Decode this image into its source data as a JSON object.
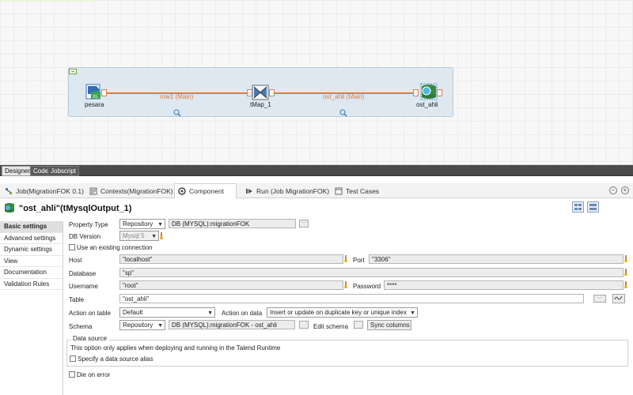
{
  "designer": {
    "components": [
      {
        "label": "pesara"
      },
      {
        "label": "tMap_1"
      },
      {
        "label": "ost_ahli"
      }
    ],
    "connections": [
      {
        "label": "row1 (Main)"
      },
      {
        "label": "ost_ahli (Main)"
      }
    ],
    "tabs": [
      "Designer",
      "Code",
      "Jobscript"
    ]
  },
  "views": {
    "tabs": [
      {
        "label": "Job(MigrationFOK 0.1)",
        "icon": "job-icon"
      },
      {
        "label": "Contexts(MigrationFOK)",
        "icon": "contexts-icon"
      },
      {
        "label": "Component",
        "icon": "component-icon"
      },
      {
        "label": "Run (Job MigrationFOK)",
        "icon": "run-icon"
      },
      {
        "label": "Test Cases",
        "icon": "testcases-icon"
      }
    ]
  },
  "component": {
    "title": "\"ost_ahli\"(tMysqlOutput_1)",
    "sidebar": [
      "Basic settings",
      "Advanced settings",
      "Dynamic settings",
      "View",
      "Documentation",
      "Validation Rules"
    ],
    "property_type": {
      "label": "Property Type",
      "value": "Repository",
      "repo": "DB (MYSQL):migrationFOK"
    },
    "db_version": {
      "label": "DB Version",
      "value": "Mysql 5"
    },
    "use_existing": {
      "label": "Use an existing connection"
    },
    "host": {
      "label": "Host",
      "value": "\"localhost\""
    },
    "port": {
      "label": "Port",
      "value": "\"3306\""
    },
    "database": {
      "label": "Database",
      "value": "\"sp\""
    },
    "username": {
      "label": "Username",
      "value": "\"root\""
    },
    "password": {
      "label": "Password",
      "value": "****"
    },
    "table": {
      "label": "Table",
      "value": "\"ost_ahli\""
    },
    "action_on_table": {
      "label": "Action on table",
      "value": "Default"
    },
    "action_on_data": {
      "label": "Action on data",
      "value": "Insert or update on duplicate key or unique index"
    },
    "schema": {
      "label": "Schema",
      "value": "Repository",
      "repo": "DB (MYSQL):migrationFOK - ost_ahli"
    },
    "edit_schema": {
      "label": "Edit schema"
    },
    "sync_columns": {
      "label": "Sync columns"
    },
    "data_source": {
      "legend": "Data source",
      "note": "This option only applies when deploying and running in the Talend Runtime",
      "specify_alias": "Specify a data source alias"
    },
    "die_on_error": {
      "label": "Die on error"
    }
  },
  "colors": {
    "connection": "#e07b3c",
    "subjob": "#dde8f1",
    "accent_green": "#6aa832"
  }
}
